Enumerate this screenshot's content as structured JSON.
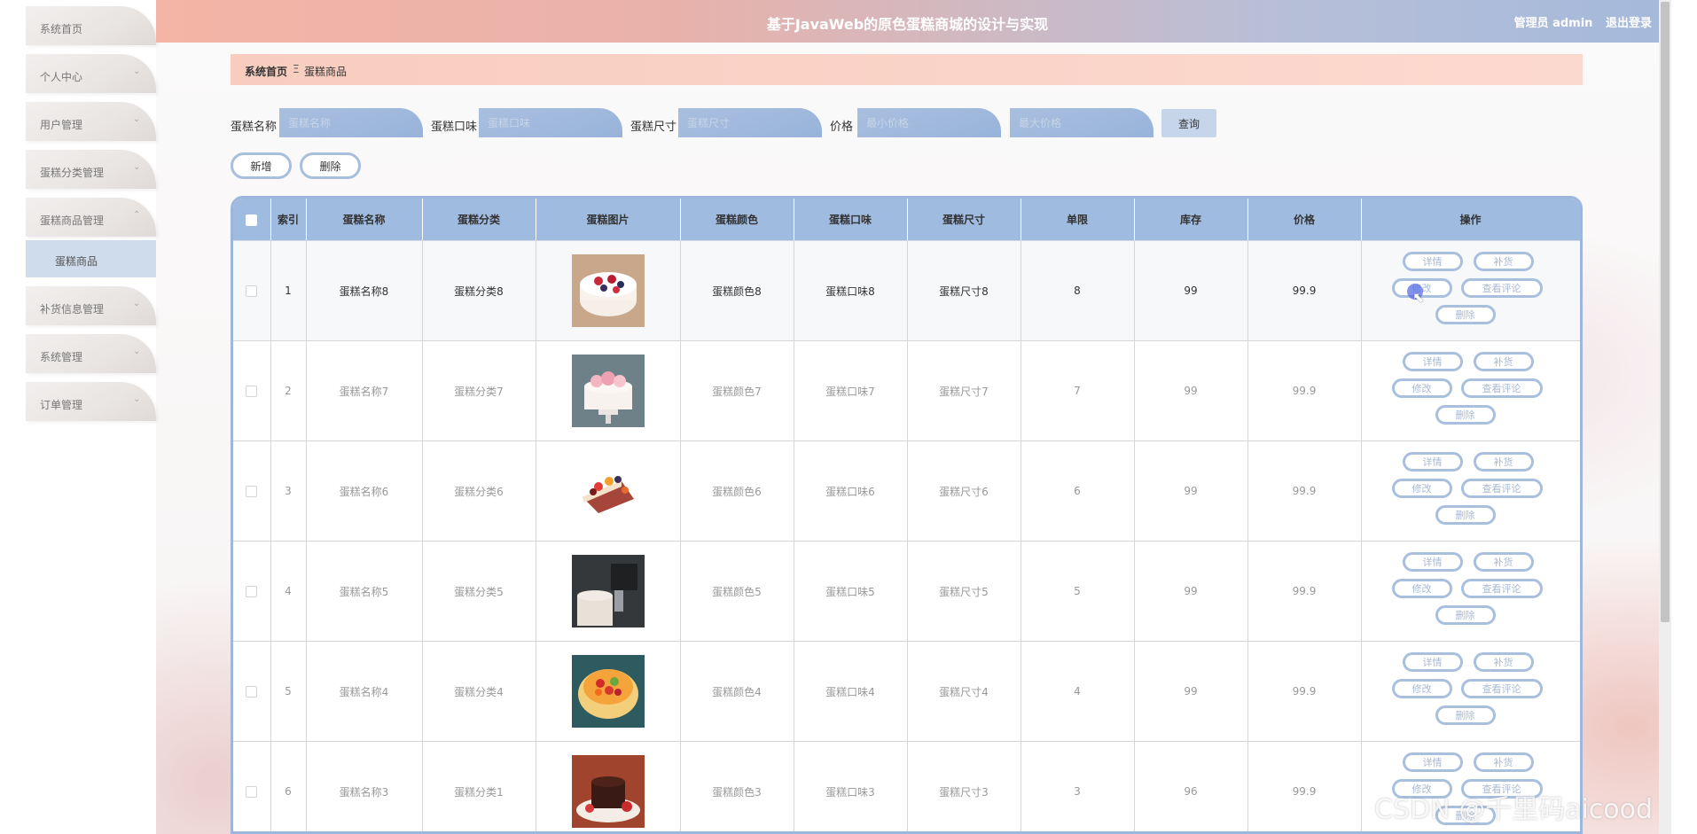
{
  "header": {
    "title": "基于JavaWeb的原色蛋糕商城的设计与实现",
    "user_label": "管理员 admin",
    "logout": "退出登录"
  },
  "sidebar": {
    "items": [
      {
        "label": "系统首页",
        "chevron": false
      },
      {
        "label": "个人中心",
        "chevron": true
      },
      {
        "label": "用户管理",
        "chevron": true
      },
      {
        "label": "蛋糕分类管理",
        "chevron": true
      },
      {
        "label": "蛋糕商品管理",
        "chevron": true,
        "expanded": true
      },
      {
        "label": "补货信息管理",
        "chevron": true
      },
      {
        "label": "系统管理",
        "chevron": true
      },
      {
        "label": "订单管理",
        "chevron": true
      }
    ],
    "sub_item": "蛋糕商品"
  },
  "breadcrumb": {
    "home": "系统首页",
    "separator": "Ξ",
    "current": "蛋糕商品"
  },
  "search": {
    "name_label": "蛋糕名称",
    "name_placeholder": "蛋糕名称",
    "flavor_label": "蛋糕口味",
    "flavor_placeholder": "蛋糕口味",
    "size_label": "蛋糕尺寸",
    "size_placeholder": "蛋糕尺寸",
    "price_label": "价格",
    "min_price_placeholder": "最小价格",
    "max_price_placeholder": "最大价格",
    "query_button": "查询"
  },
  "actions": {
    "add": "新增",
    "delete": "删除"
  },
  "table": {
    "headers": [
      "索引",
      "蛋糕名称",
      "蛋糕分类",
      "蛋糕图片",
      "蛋糕颜色",
      "蛋糕口味",
      "蛋糕尺寸",
      "单限",
      "库存",
      "价格",
      "操作"
    ],
    "row_buttons": {
      "detail": "详情",
      "restock": "补货",
      "edit": "修改",
      "review": "查看评论",
      "delete": "删除"
    },
    "rows": [
      {
        "index": "1",
        "name": "蛋糕名称8",
        "category": "蛋糕分类8",
        "image": "cake-berry-cream",
        "color": "蛋糕颜色8",
        "flavor": "蛋糕口味8",
        "size": "蛋糕尺寸8",
        "limit": "8",
        "stock": "99",
        "price": "99.9"
      },
      {
        "index": "2",
        "name": "蛋糕名称7",
        "category": "蛋糕分类7",
        "image": "cake-pink-roses",
        "color": "蛋糕颜色7",
        "flavor": "蛋糕口味7",
        "size": "蛋糕尺寸7",
        "limit": "7",
        "stock": "99",
        "price": "99.9"
      },
      {
        "index": "3",
        "name": "蛋糕名称6",
        "category": "蛋糕分类6",
        "image": "cake-fruit-slice",
        "color": "蛋糕颜色6",
        "flavor": "蛋糕口味6",
        "size": "蛋糕尺寸6",
        "limit": "6",
        "stock": "99",
        "price": "99.9"
      },
      {
        "index": "4",
        "name": "蛋糕名称5",
        "category": "蛋糕分类5",
        "image": "cake-dark-mixer",
        "color": "蛋糕颜色5",
        "flavor": "蛋糕口味5",
        "size": "蛋糕尺寸5",
        "limit": "5",
        "stock": "99",
        "price": "99.9"
      },
      {
        "index": "5",
        "name": "蛋糕名称4",
        "category": "蛋糕分类4",
        "image": "cake-fruit-charlotte",
        "color": "蛋糕颜色4",
        "flavor": "蛋糕口味4",
        "size": "蛋糕尺寸4",
        "limit": "4",
        "stock": "99",
        "price": "99.9"
      },
      {
        "index": "6",
        "name": "蛋糕名称3",
        "category": "蛋糕分类1",
        "image": "cake-chocolate-lava",
        "color": "蛋糕颜色3",
        "flavor": "蛋糕口味3",
        "size": "蛋糕尺寸3",
        "limit": "3",
        "stock": "96",
        "price": "99.9"
      }
    ]
  },
  "watermark": "CSDN @千里码aicood",
  "colors": {
    "accent_blue": "#9fbbe0",
    "header_peach": "#f4b4a6",
    "breadcrumb_bg": "#fcd9cf"
  }
}
